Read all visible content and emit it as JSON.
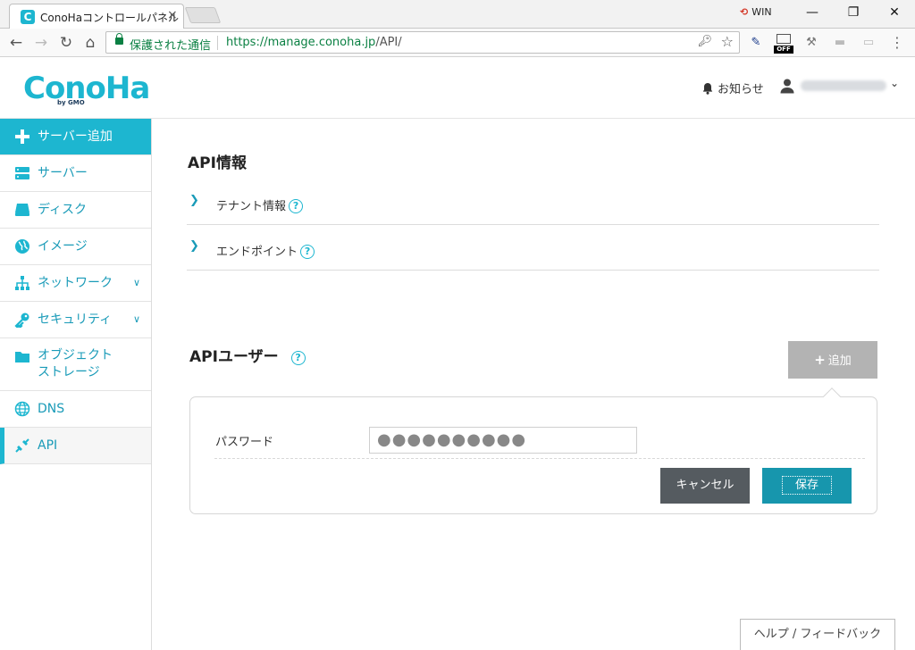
{
  "browser": {
    "tab_title": "ConoHaコントロールパネル",
    "tab_favicon": "C",
    "win_badge": "WIN",
    "secure_label": "保護された通信",
    "url_host": "https://manage.conoha.jp",
    "url_path": "/API/",
    "ext_off_label": "OFF"
  },
  "header": {
    "logo": "ConoHa",
    "logo_sub": "by GMO",
    "notice_label": "お知らせ"
  },
  "sidebar": {
    "items": [
      {
        "label": "サーバー追加",
        "icon": "plus-icon"
      },
      {
        "label": "サーバー",
        "icon": "server-icon"
      },
      {
        "label": "ディスク",
        "icon": "disk-icon"
      },
      {
        "label": "イメージ",
        "icon": "globe-image-icon"
      },
      {
        "label": "ネットワーク",
        "icon": "network-icon"
      },
      {
        "label": "セキュリティ",
        "icon": "key-icon"
      },
      {
        "label": "オブジェクト",
        "label2": "ストレージ",
        "icon": "folder-icon"
      },
      {
        "label": "DNS",
        "icon": "globe-icon"
      },
      {
        "label": "API",
        "icon": "api-icon"
      }
    ]
  },
  "main": {
    "api_info_title": "API情報",
    "tenant_label": "テナント情報",
    "endpoint_label": "エンドポイント",
    "help_glyph": "?",
    "api_user_title": "APIユーザー",
    "add_button": "追加",
    "password_label": "パスワード",
    "password_value": "●●●●●●●●●●",
    "cancel_button": "キャンセル",
    "save_button": "保存",
    "help_feedback": "ヘルプ / フィードバック"
  },
  "colors": {
    "accent": "#1db6d0",
    "save": "#1796ad",
    "cancel": "#555b60",
    "add_disabled": "#b3b3b3"
  }
}
